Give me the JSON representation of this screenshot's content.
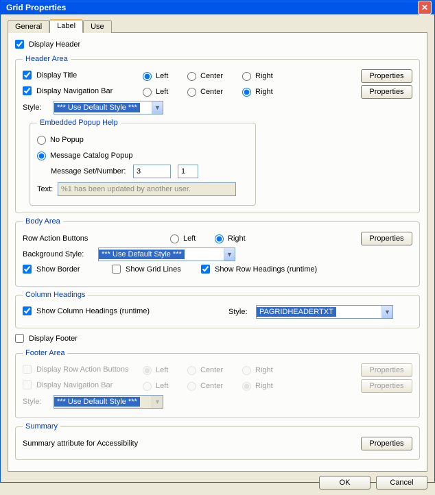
{
  "window": {
    "title": "Grid Properties"
  },
  "tabs": {
    "general": "General",
    "label": "Label",
    "use": "Use"
  },
  "top": {
    "display_header": "Display Header"
  },
  "header_area": {
    "legend": "Header Area",
    "display_title": "Display Title",
    "display_navbar": "Display Navigation Bar",
    "left": "Left",
    "center": "Center",
    "right": "Right",
    "properties": "Properties",
    "style_label": "Style:",
    "style_value": "*** Use Default Style ***",
    "embedded_popup": {
      "legend": "Embedded Popup Help",
      "no_popup": "No Popup",
      "msg_catalog": "Message Catalog Popup",
      "msg_setnum_label": "Message Set/Number:",
      "msg_set": "3",
      "msg_num": "1",
      "text_label": "Text:",
      "text_value": "%1 has been updated by another user."
    }
  },
  "body_area": {
    "legend": "Body Area",
    "row_action_buttons": "Row Action Buttons",
    "left": "Left",
    "right": "Right",
    "properties": "Properties",
    "bg_style_label": "Background Style:",
    "bg_style_value": "*** Use Default Style ***",
    "show_border": "Show Border",
    "show_grid_lines": "Show Grid Lines",
    "show_row_headings": "Show Row Headings (runtime)"
  },
  "column_headings": {
    "legend": "Column Headings",
    "show_col_headings": "Show Column Headings (runtime)",
    "style_label": "Style:",
    "style_value": "PAGRIDHEADERTXT"
  },
  "display_footer": "Display Footer",
  "footer_area": {
    "legend": "Footer Area",
    "display_row_action": "Display Row Action Buttons",
    "display_navbar": "Display Navigation Bar",
    "left": "Left",
    "center": "Center",
    "right": "Right",
    "properties": "Properties",
    "style_label": "Style:",
    "style_value": "*** Use Default Style ***"
  },
  "summary": {
    "legend": "Summary",
    "text": "Summary attribute for Accessibility",
    "properties": "Properties"
  },
  "buttons": {
    "ok": "OK",
    "cancel": "Cancel"
  }
}
